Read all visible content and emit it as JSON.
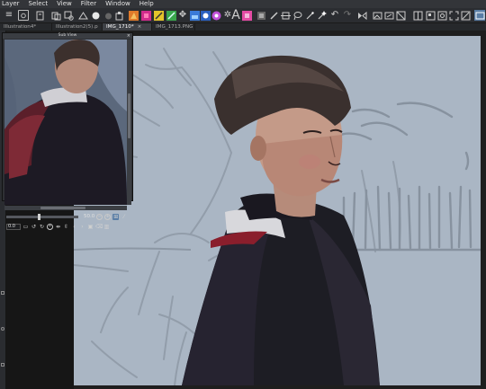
{
  "menu": [
    "Layer",
    "Select",
    "View",
    "Filter",
    "Window",
    "Help"
  ],
  "tabs": [
    {
      "label": "Illustration4*",
      "active": false
    },
    {
      "label": "Illustration2(5).p",
      "active": false
    },
    {
      "label": "IMG_1710*",
      "active": true
    },
    {
      "label": "IMG_1713.PNG",
      "active": false
    }
  ],
  "tab_close_glyph": "×",
  "sub_view": {
    "title": "Sub View",
    "close_glyph": "×",
    "zoom": "50.0",
    "angle": "0.0"
  },
  "toolbar_icons": [
    "menu-icon",
    "capture-icon",
    "new-file-icon",
    "open-icon",
    "save-icon",
    "print-icon",
    "color-circle-icon",
    "layer-icon",
    "colorset-1-icon",
    "colorset-2-icon",
    "colorset-3-icon",
    "colorset-4-icon",
    "move-icon",
    "fill-icon",
    "gradient-icon",
    "figure-icon",
    "text-icon",
    "balloon-icon",
    "frame-icon",
    "ruler-icon",
    "lasso-icon",
    "wand-icon",
    "undo-icon",
    "redo-icon",
    "flip-icon",
    "view-1-icon",
    "view-2-icon",
    "view-3-icon",
    "panel-icon",
    "settings-icon",
    "zoom-fit-icon",
    "fullscreen-icon"
  ],
  "colors": {
    "canvas_bg": "#aab6c4",
    "accent": "#5a7ea6",
    "orange": "#e07a2a",
    "magenta": "#d02c8c",
    "yellow": "#e4c42a",
    "green": "#3aa64c",
    "blue": "#3a7ad8",
    "pink": "#e44ca4"
  }
}
